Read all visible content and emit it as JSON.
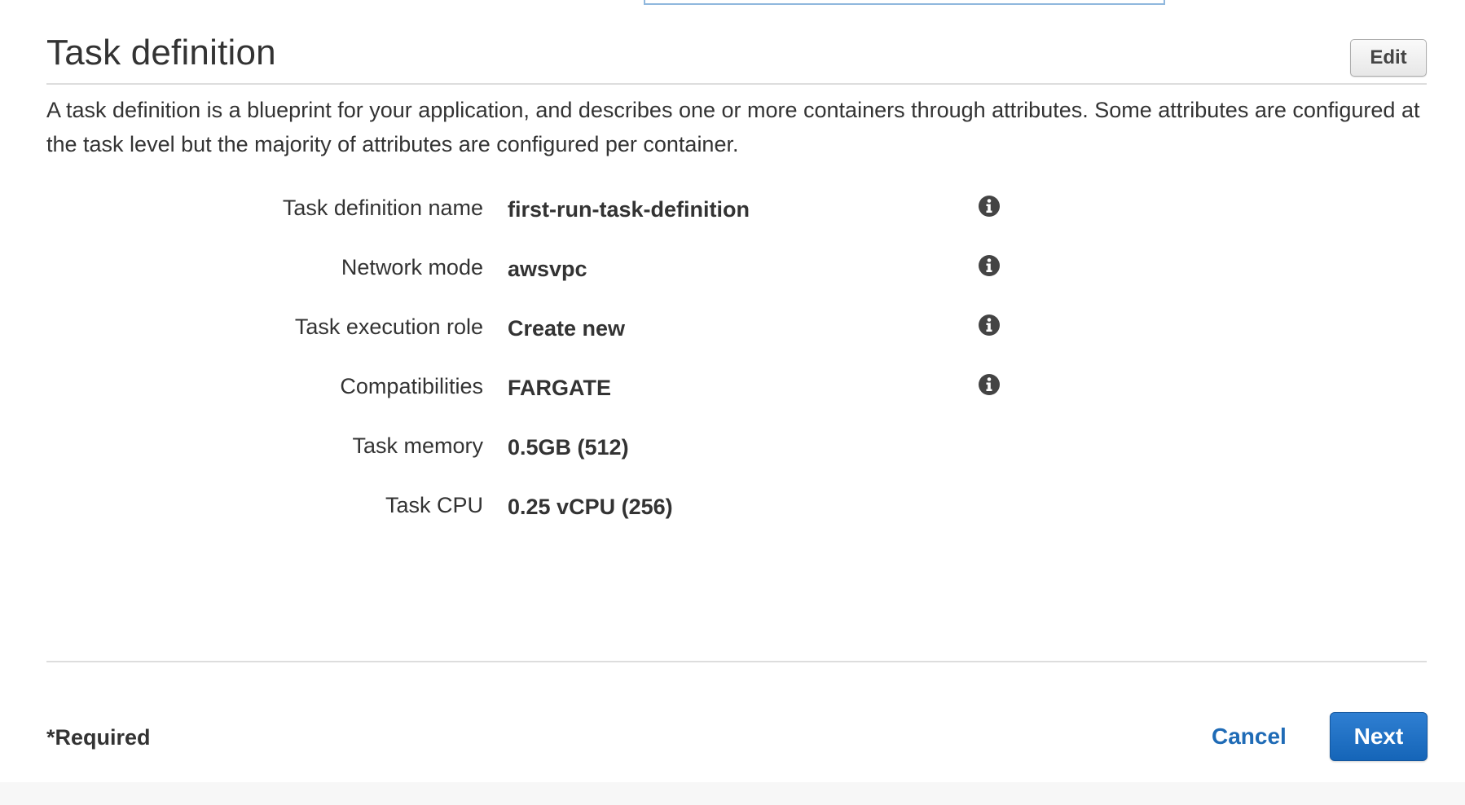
{
  "header": {
    "title": "Task definition",
    "edit_label": "Edit"
  },
  "description": "A task definition is a blueprint for your application, and describes one or more containers through attributes. Some attributes are configured at the task level but the majority of attributes are configured per container.",
  "fields": [
    {
      "label": "Task definition name",
      "value": "first-run-task-definition",
      "icon": "info-icon"
    },
    {
      "label": "Network mode",
      "value": "awsvpc",
      "icon": "info-icon"
    },
    {
      "label": "Task execution role",
      "value": "Create new",
      "icon": "info-icon"
    },
    {
      "label": "Compatibilities",
      "value": "FARGATE",
      "icon": "info-icon"
    },
    {
      "label": "Task memory",
      "value": "0.5GB (512)"
    },
    {
      "label": "Task CPU",
      "value": "0.25 vCPU (256)"
    }
  ],
  "footer": {
    "required_note": "*Required",
    "cancel_label": "Cancel",
    "next_label": "Next"
  },
  "colors": {
    "text": "#333333",
    "link": "#1f6bb6",
    "primary_button": "#1565b8",
    "divider": "#dddddd",
    "info_icon": "#444444"
  }
}
